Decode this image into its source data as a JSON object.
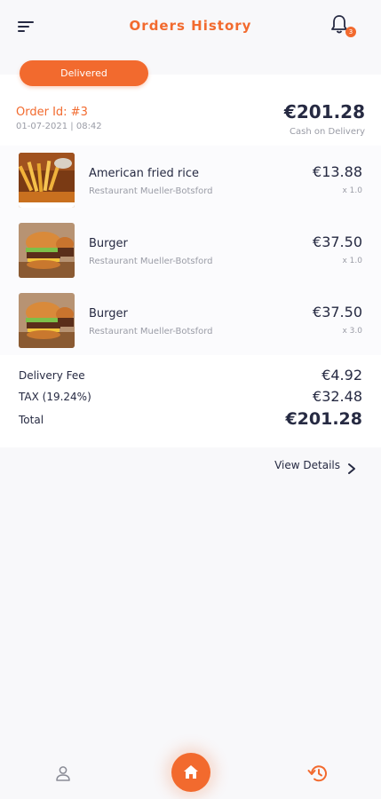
{
  "header": {
    "title": "Orders History",
    "notification_count": "3",
    "menu_icon": "menu-icon",
    "bell_icon": "bell-icon"
  },
  "status": {
    "label": "Delivered"
  },
  "order": {
    "id_label": "Order Id: #3",
    "datetime": "01-07-2021 | 08:42",
    "total": "€201.28",
    "payment": "Cash on Delivery"
  },
  "items": [
    {
      "name": "American fried rice",
      "restaurant": "Restaurant Mueller-Botsford",
      "price": "€13.88",
      "qty": "x 1.0",
      "image": "fries-photo"
    },
    {
      "name": "Burger",
      "restaurant": "Restaurant Mueller-Botsford",
      "price": "€37.50",
      "qty": "x 1.0",
      "image": "burger-photo"
    },
    {
      "name": "Burger",
      "restaurant": "Restaurant Mueller-Botsford",
      "price": "€37.50",
      "qty": "x 3.0",
      "image": "burger-photo"
    }
  ],
  "fees": {
    "delivery_label": "Delivery Fee",
    "delivery_value": "€4.92",
    "tax_label": "TAX (19.24%)",
    "tax_value": "€32.48",
    "total_label": "Total",
    "total_value": "€201.28"
  },
  "actions": {
    "view_details": "View Details"
  },
  "nav": {
    "profile_icon": "user-icon",
    "home_icon": "home-icon",
    "history_icon": "history-icon"
  },
  "colors": {
    "accent": "#f26a2e",
    "text": "#262a42",
    "muted": "#9a9ca6",
    "background": "#f8f8fa"
  }
}
